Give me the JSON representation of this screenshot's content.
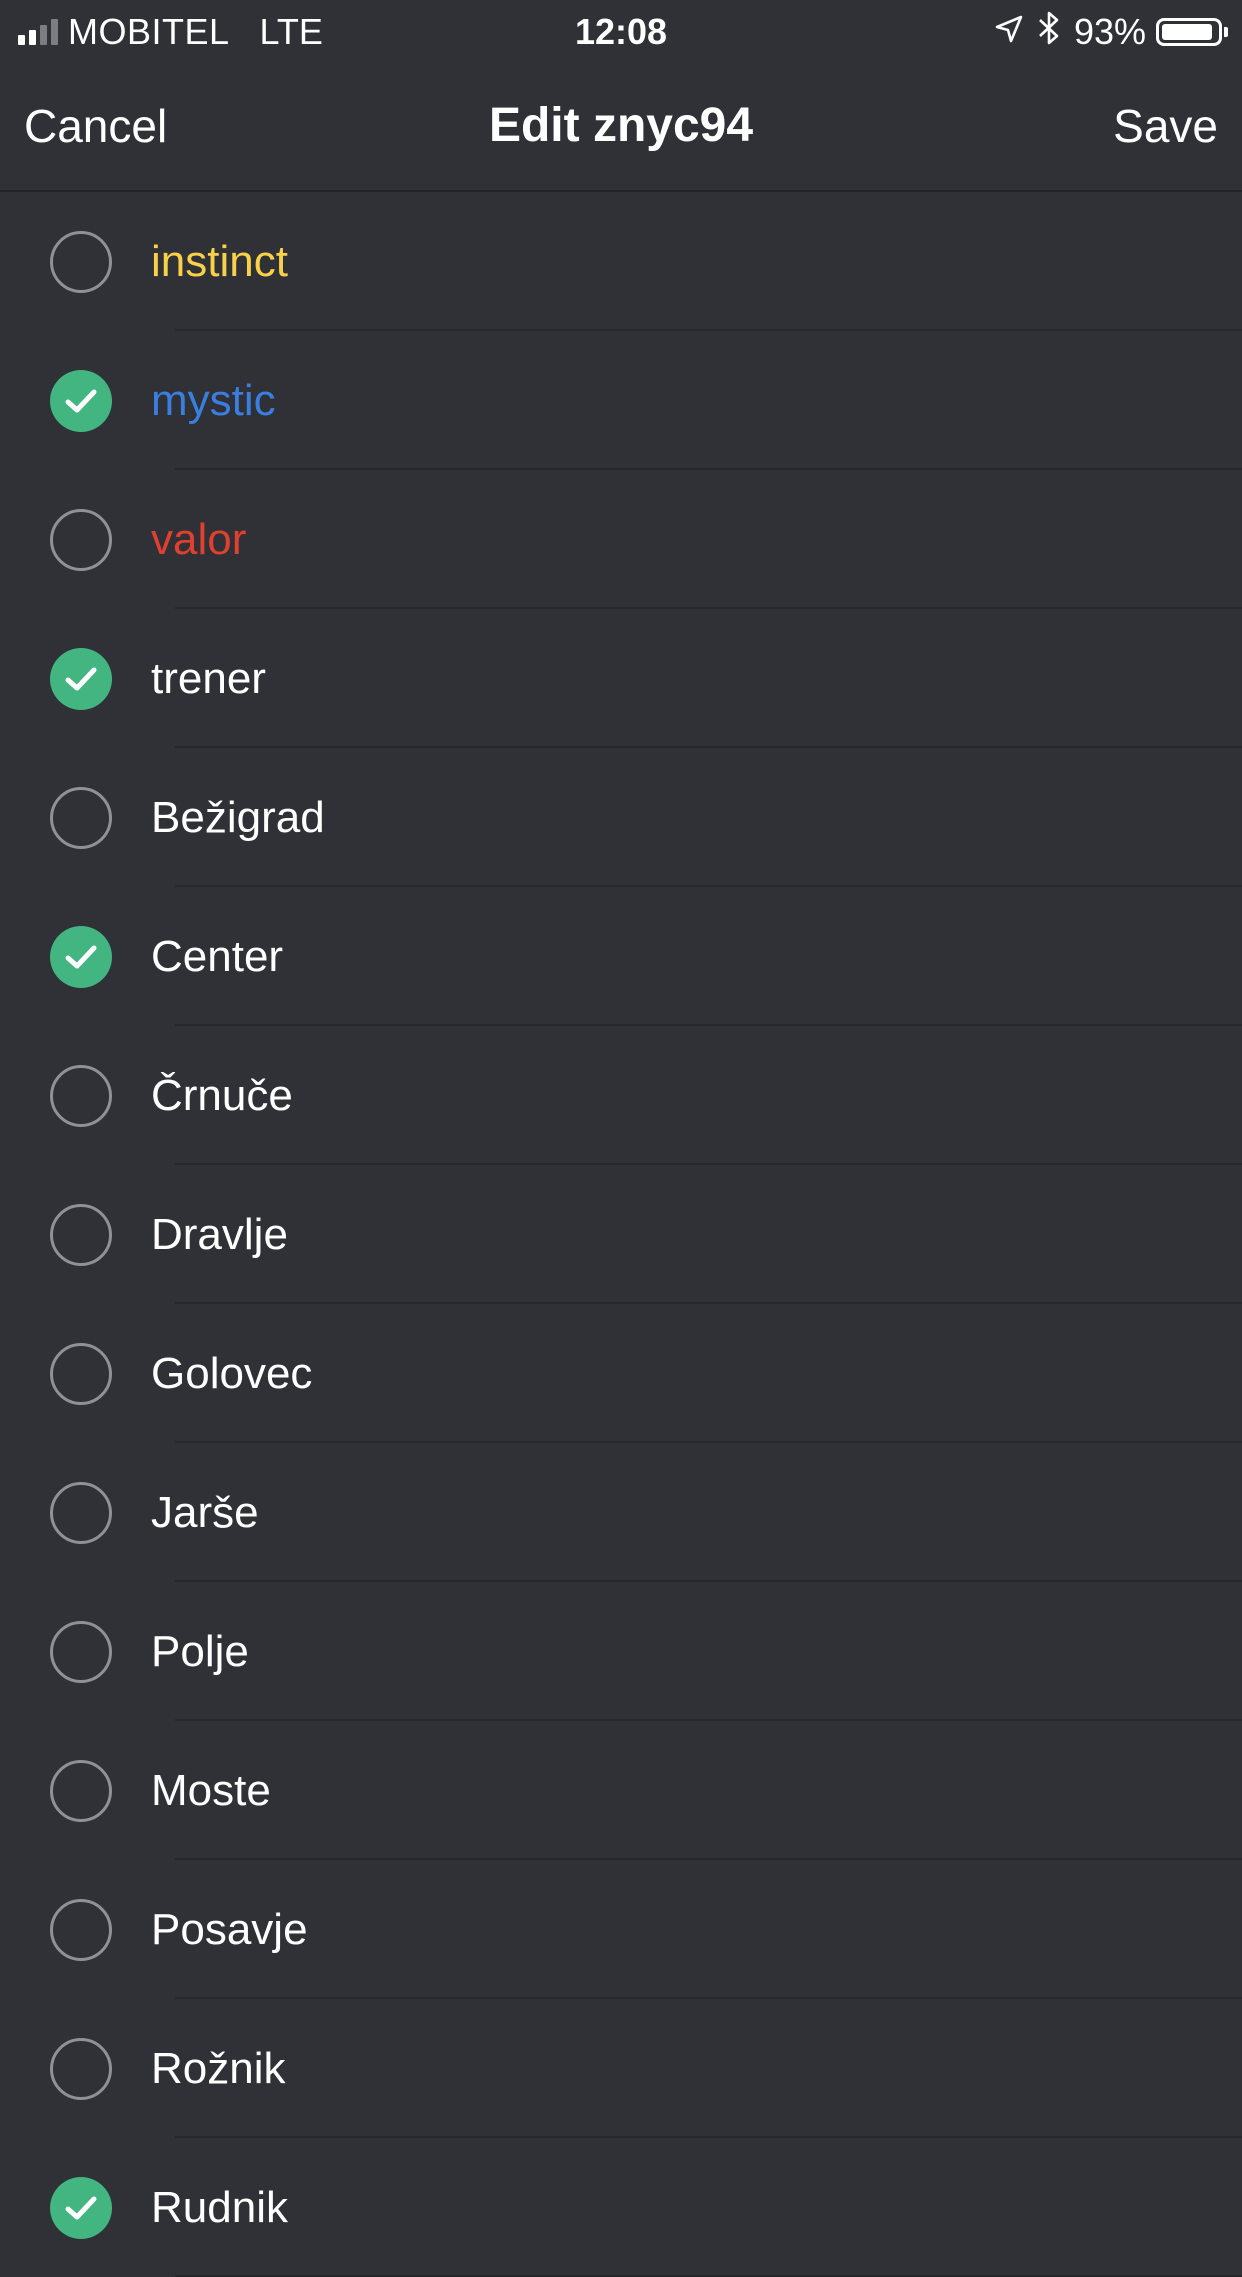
{
  "status_bar": {
    "carrier": "MOBITEL",
    "network": "LTE",
    "time": "12:08",
    "battery": "93%",
    "battery_level": 0.93,
    "icons": [
      "signal-icon",
      "location-icon",
      "bluetooth-icon",
      "battery-icon"
    ]
  },
  "nav": {
    "cancel_label": "Cancel",
    "title": "Edit znyc94",
    "save_label": "Save"
  },
  "colors": {
    "background": "#2f3136",
    "checked": "#43b581",
    "instinct": "#f8d049",
    "mystic": "#3a7ee0",
    "valor": "#e0402f"
  },
  "roles": [
    {
      "label": "instinct",
      "checked": false,
      "color": "#f8d049"
    },
    {
      "label": "mystic",
      "checked": true,
      "color": "#3a7ee0"
    },
    {
      "label": "valor",
      "checked": false,
      "color": "#e0402f"
    },
    {
      "label": "trener",
      "checked": true,
      "color": "#ffffff"
    },
    {
      "label": "Bežigrad",
      "checked": false,
      "color": "#ffffff"
    },
    {
      "label": "Center",
      "checked": true,
      "color": "#ffffff"
    },
    {
      "label": "Črnuče",
      "checked": false,
      "color": "#ffffff"
    },
    {
      "label": "Dravlje",
      "checked": false,
      "color": "#ffffff"
    },
    {
      "label": "Golovec",
      "checked": false,
      "color": "#ffffff"
    },
    {
      "label": "Jarše",
      "checked": false,
      "color": "#ffffff"
    },
    {
      "label": "Polje",
      "checked": false,
      "color": "#ffffff"
    },
    {
      "label": "Moste",
      "checked": false,
      "color": "#ffffff"
    },
    {
      "label": "Posavje",
      "checked": false,
      "color": "#ffffff"
    },
    {
      "label": "Rožnik",
      "checked": false,
      "color": "#ffffff"
    },
    {
      "label": "Rudnik",
      "checked": true,
      "color": "#ffffff"
    }
  ]
}
